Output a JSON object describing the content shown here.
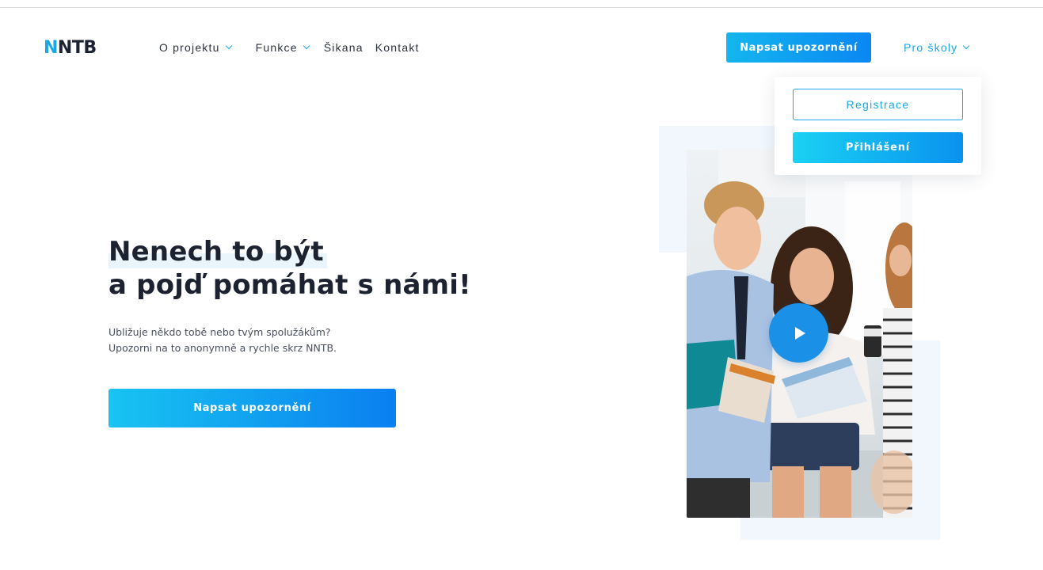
{
  "header": {
    "logo_accent": "N",
    "logo_rest": "NTB",
    "nav": [
      {
        "label": "O projektu",
        "has_dropdown": true
      },
      {
        "label": "Funkce",
        "has_dropdown": true
      },
      {
        "label": "Šikana",
        "has_dropdown": false
      },
      {
        "label": "Kontakt",
        "has_dropdown": false
      }
    ],
    "cta_label": "Napsat upozornění",
    "schools_label": "Pro školy"
  },
  "dropdown": {
    "register_label": "Registrace",
    "login_label": "Přihlášení"
  },
  "hero": {
    "title_line1": "Nenech to být",
    "title_line2": "a pojď pomáhat s námi!",
    "subtitle_line1": "Ubližuje někdo tobě nebo tvým spolužákům?",
    "subtitle_line2": "Upozorni na to anonymně a rychle skrz NNTB.",
    "cta_label": "Napsat upozornění"
  },
  "colors": {
    "accent": "#1aa7e8",
    "text_dark": "#1c2230",
    "deco_background": "#f1f7fd",
    "play_button": "#1a90e6"
  },
  "icons": {
    "nav_chevron": "chevron-down-icon",
    "play": "play-icon"
  }
}
